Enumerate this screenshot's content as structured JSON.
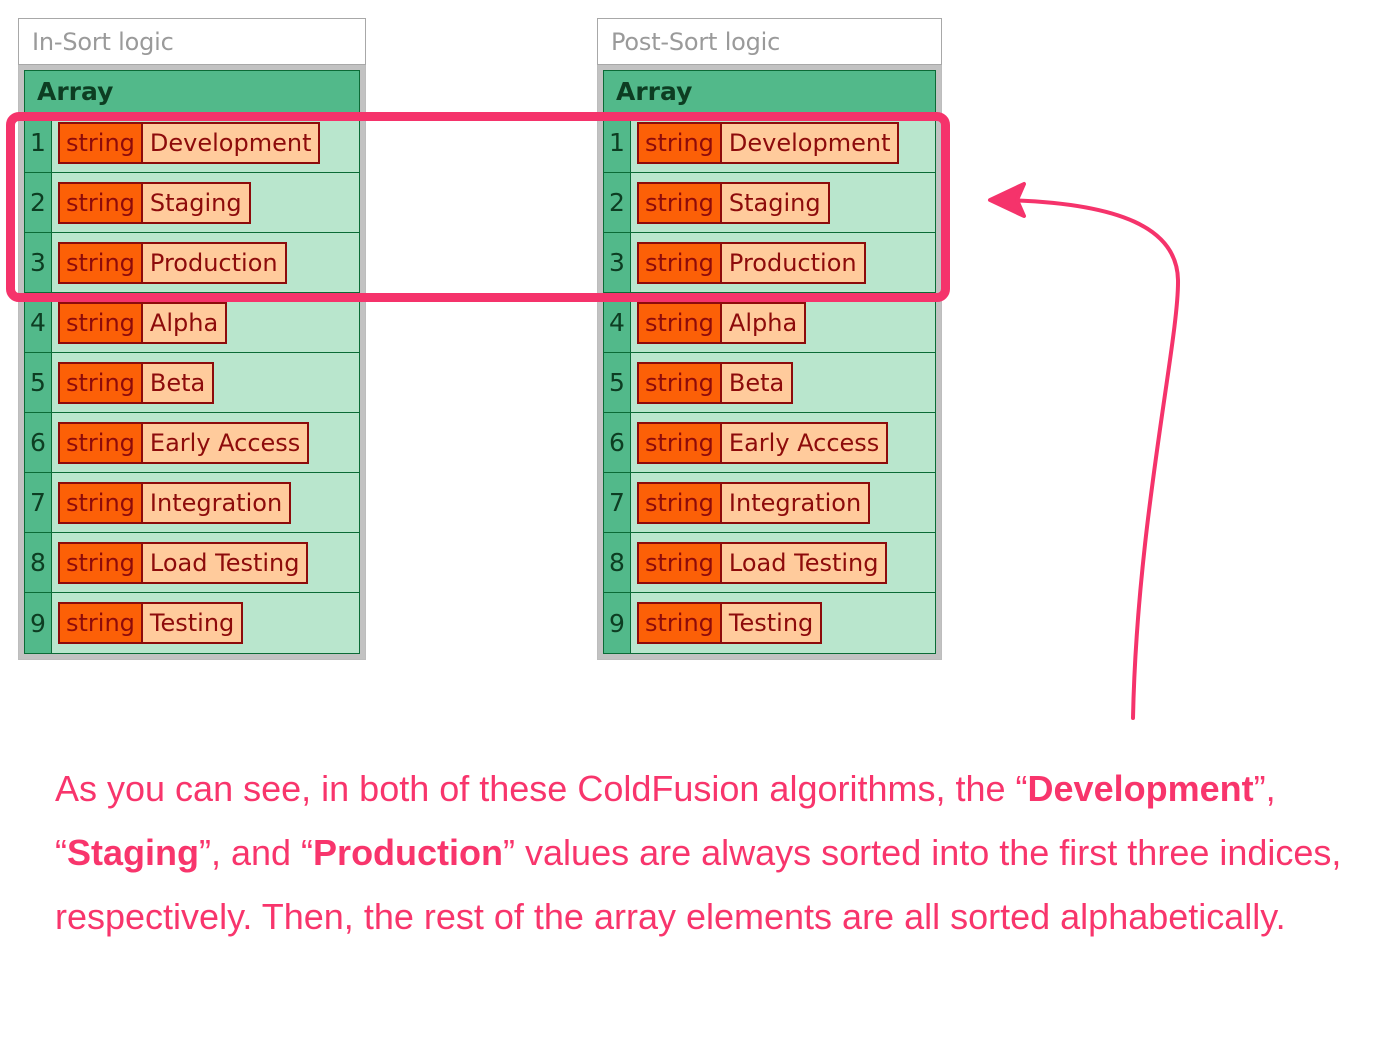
{
  "panels": [
    {
      "header": "In-Sort logic",
      "table_title": "Array",
      "rows": [
        {
          "index": "1",
          "type": "string",
          "value": "Development"
        },
        {
          "index": "2",
          "type": "string",
          "value": "Staging"
        },
        {
          "index": "3",
          "type": "string",
          "value": "Production"
        },
        {
          "index": "4",
          "type": "string",
          "value": "Alpha"
        },
        {
          "index": "5",
          "type": "string",
          "value": "Beta"
        },
        {
          "index": "6",
          "type": "string",
          "value": "Early Access"
        },
        {
          "index": "7",
          "type": "string",
          "value": "Integration"
        },
        {
          "index": "8",
          "type": "string",
          "value": "Load Testing"
        },
        {
          "index": "9",
          "type": "string",
          "value": "Testing"
        }
      ]
    },
    {
      "header": "Post-Sort logic",
      "table_title": "Array",
      "rows": [
        {
          "index": "1",
          "type": "string",
          "value": "Development"
        },
        {
          "index": "2",
          "type": "string",
          "value": "Staging"
        },
        {
          "index": "3",
          "type": "string",
          "value": "Production"
        },
        {
          "index": "4",
          "type": "string",
          "value": "Alpha"
        },
        {
          "index": "5",
          "type": "string",
          "value": "Beta"
        },
        {
          "index": "6",
          "type": "string",
          "value": "Early Access"
        },
        {
          "index": "7",
          "type": "string",
          "value": "Integration"
        },
        {
          "index": "8",
          "type": "string",
          "value": "Load Testing"
        },
        {
          "index": "9",
          "type": "string",
          "value": "Testing"
        }
      ]
    }
  ],
  "annotation": {
    "highlight_color": "#f5336b",
    "arrow_color": "#f5336b",
    "arrow_icon": "left-arrow-icon"
  },
  "caption": {
    "segments": [
      {
        "text": "As you can see, in both of these ColdFusion algorithms, the “",
        "bold": false
      },
      {
        "text": "Development",
        "bold": true
      },
      {
        "text": "”, “",
        "bold": false
      },
      {
        "text": "Staging",
        "bold": true
      },
      {
        "text": "”, and “",
        "bold": false
      },
      {
        "text": "Production",
        "bold": true
      },
      {
        "text": "” values are always sorted into the first three indices, respectively. Then, the rest of the array elements are all sorted alphabetically.",
        "bold": false
      }
    ],
    "color": "#f8356c"
  },
  "colors": {
    "table_header_green": "#52b98a",
    "table_body_green": "#b9e6cd",
    "table_border_green": "#0b6b36",
    "chip_type_orange": "#fc6007",
    "chip_value_peach": "#ffcb9c",
    "chip_border_darkred": "#8d0b0b",
    "panel_frame_gray": "#bdbdbd",
    "panel_header_text_gray": "#9a9a9a",
    "accent_pink": "#f5336b"
  }
}
